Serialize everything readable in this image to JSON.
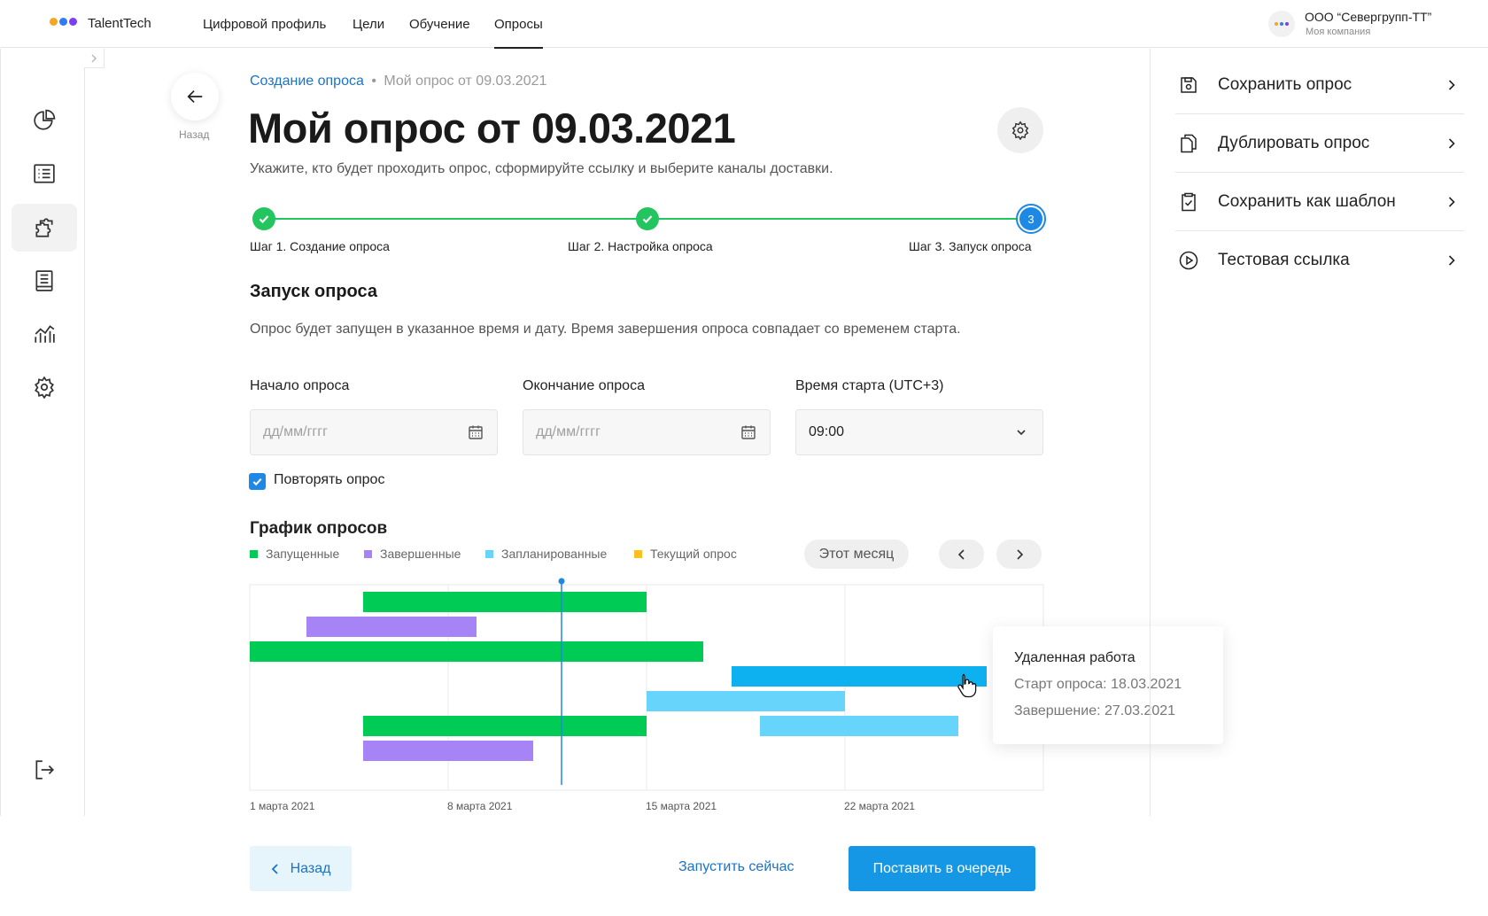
{
  "app": {
    "name": "TalentTech",
    "logo_colors": [
      "#f5a623",
      "#2f7bf6",
      "#7b3ff2"
    ]
  },
  "nav": {
    "items": [
      {
        "label": "Цифровой профиль"
      },
      {
        "label": "Цели"
      },
      {
        "label": "Обучение"
      },
      {
        "label": "Опросы",
        "active": true
      }
    ]
  },
  "company": {
    "name": "ООО “Севергрупп-ТТ”",
    "subtitle": "Моя компания"
  },
  "sidebar": {
    "icons": [
      "pie-chart-icon",
      "list-icon",
      "puzzle-icon",
      "book-icon",
      "analytics-icon",
      "settings-icon",
      "logout-icon"
    ],
    "active": "puzzle-icon"
  },
  "back": {
    "label": "Назад"
  },
  "breadcrumb": {
    "link": "Создание опроса",
    "separator": "•",
    "current": "Мой опрос от 09.03.2021"
  },
  "page": {
    "title": "Мой опрос от 09.03.2021",
    "subtitle": "Укажите, кто будет проходить опрос, сформируйте ссылку и выберите каналы доставки."
  },
  "stepper": {
    "steps": [
      {
        "label": "Шаг 1. Создание опроса",
        "status": "done"
      },
      {
        "label": "Шаг 2. Настройка опроса",
        "status": "done"
      },
      {
        "label": "Шаг 3. Запуск опроса",
        "status": "current",
        "number": "3"
      }
    ],
    "color_done": "#22c55e",
    "color_current": "#1e88e5"
  },
  "launch": {
    "title": "Запуск опроса",
    "description": "Опрос будет запущен в указанное время и дату. Время завершения опроса совпадает со временем старта.",
    "start_label": "Начало опроса",
    "start_placeholder": "дд/мм/гггг",
    "end_label": "Окончание опроса",
    "end_placeholder": "дд/мм/гггг",
    "time_label": "Время старта (UTC+3)",
    "time_value": "09:00",
    "repeat_label": "Повторять опрос",
    "repeat_checked": true
  },
  "chart_section": {
    "title": "График опросов",
    "month_button": "Этот месяц",
    "prev_icon": "chevron-left-icon",
    "next_icon": "chevron-right-icon"
  },
  "chart_data": {
    "type": "gantt",
    "legend": [
      {
        "label": "Запущенные",
        "color": "#00cc55"
      },
      {
        "label": "Завершенные",
        "color": "#a784f5"
      },
      {
        "label": "Запланированные",
        "color": "#67d4fb"
      },
      {
        "label": "Текущий опрос",
        "color": "#ffc01f"
      }
    ],
    "x_ticks": [
      "1 марта 2021",
      "8 марта 2021",
      "15 марта 2021",
      "22 марта 2021"
    ],
    "x_range": [
      "2021-03-01",
      "2021-03-29"
    ],
    "today": "2021-03-12",
    "bars": [
      {
        "row": 0,
        "start": "2021-03-05",
        "end": "2021-03-15",
        "status": "Запущенные"
      },
      {
        "row": 1,
        "start": "2021-03-03",
        "end": "2021-03-09",
        "status": "Завершенные"
      },
      {
        "row": 2,
        "start": "2021-03-01",
        "end": "2021-03-17",
        "status": "Запущенные"
      },
      {
        "row": 3,
        "start": "2021-03-18",
        "end": "2021-03-27",
        "status": "Запланированные",
        "highlighted": true,
        "color": "#0db1ef"
      },
      {
        "row": 4,
        "start": "2021-03-15",
        "end": "2021-03-22",
        "status": "Запланированные"
      },
      {
        "row": 5,
        "start": "2021-03-19",
        "end": "2021-03-26",
        "status": "Запланированные"
      },
      {
        "row": 6,
        "start": "2021-03-05",
        "end": "2021-03-15",
        "status": "Запущенные"
      },
      {
        "row": 7,
        "start": "2021-03-05",
        "end": "2021-03-11",
        "status": "Завершенные"
      }
    ],
    "tooltip": {
      "title": "Удаленная работа",
      "start": "Старт опроса: 18.03.2021",
      "end": "Завершение: 27.03.2021"
    }
  },
  "footer": {
    "back_label": "Назад",
    "launch_now": "Запустить сейчас",
    "queue": "Поставить в очередь"
  },
  "right_panel": {
    "actions": [
      {
        "label": "Сохранить опрос",
        "icon": "save-icon"
      },
      {
        "label": "Дублировать опрос",
        "icon": "duplicate-icon"
      },
      {
        "label": "Сохранить как шаблон",
        "icon": "clipboard-check-icon"
      },
      {
        "label": "Тестовая ссылка",
        "icon": "play-circle-icon"
      }
    ]
  }
}
